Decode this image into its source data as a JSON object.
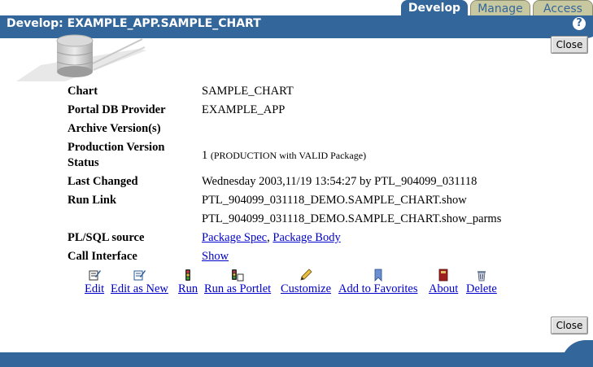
{
  "tabs": {
    "develop": "Develop",
    "manage": "Manage",
    "access": "Access"
  },
  "header": {
    "title": "Develop: EXAMPLE_APP.SAMPLE_CHART",
    "help": "?"
  },
  "buttons": {
    "close_top": "Close",
    "close_bottom": "Close"
  },
  "details": {
    "chart_label": "Chart",
    "chart_value": "SAMPLE_CHART",
    "provider_label": "Portal DB Provider",
    "provider_value": "EXAMPLE_APP",
    "archive_label": "Archive Version(s)",
    "archive_value": "",
    "production_label_1": "Production Version",
    "production_label_2": "Status",
    "production_value_num": "1",
    "production_value_note": "(PRODUCTION with VALID Package)",
    "last_changed_label": "Last Changed",
    "last_changed_value": "Wednesday 2003,11/19 13:54:27 by PTL_904099_031118",
    "run_link_label": "Run Link",
    "run_link_1": "PTL_904099_031118_DEMO.SAMPLE_CHART.show",
    "run_link_2": "PTL_904099_031118_DEMO.SAMPLE_CHART.show_parms",
    "plsql_label": "PL/SQL source",
    "plsql_spec": "Package Spec",
    "plsql_sep": ",",
    "plsql_body": "Package Body",
    "call_label": "Call Interface",
    "call_value": "Show"
  },
  "actions": [
    {
      "label": "Edit",
      "icon": "edit-icon"
    },
    {
      "label": "Edit as New",
      "icon": "edit-as-new-icon"
    },
    {
      "label": "Run",
      "icon": "run-icon"
    },
    {
      "label": "Run as Portlet",
      "icon": "run-as-portlet-icon"
    },
    {
      "label": "Customize",
      "icon": "pencil-icon"
    },
    {
      "label": "Add to Favorites",
      "icon": "bookmark-icon"
    },
    {
      "label": "About",
      "icon": "book-icon"
    },
    {
      "label": "Delete",
      "icon": "trash-icon"
    }
  ],
  "colors": {
    "accent": "#33669a",
    "inactive_tab": "#c8c8a0",
    "link": "#0000cc"
  }
}
